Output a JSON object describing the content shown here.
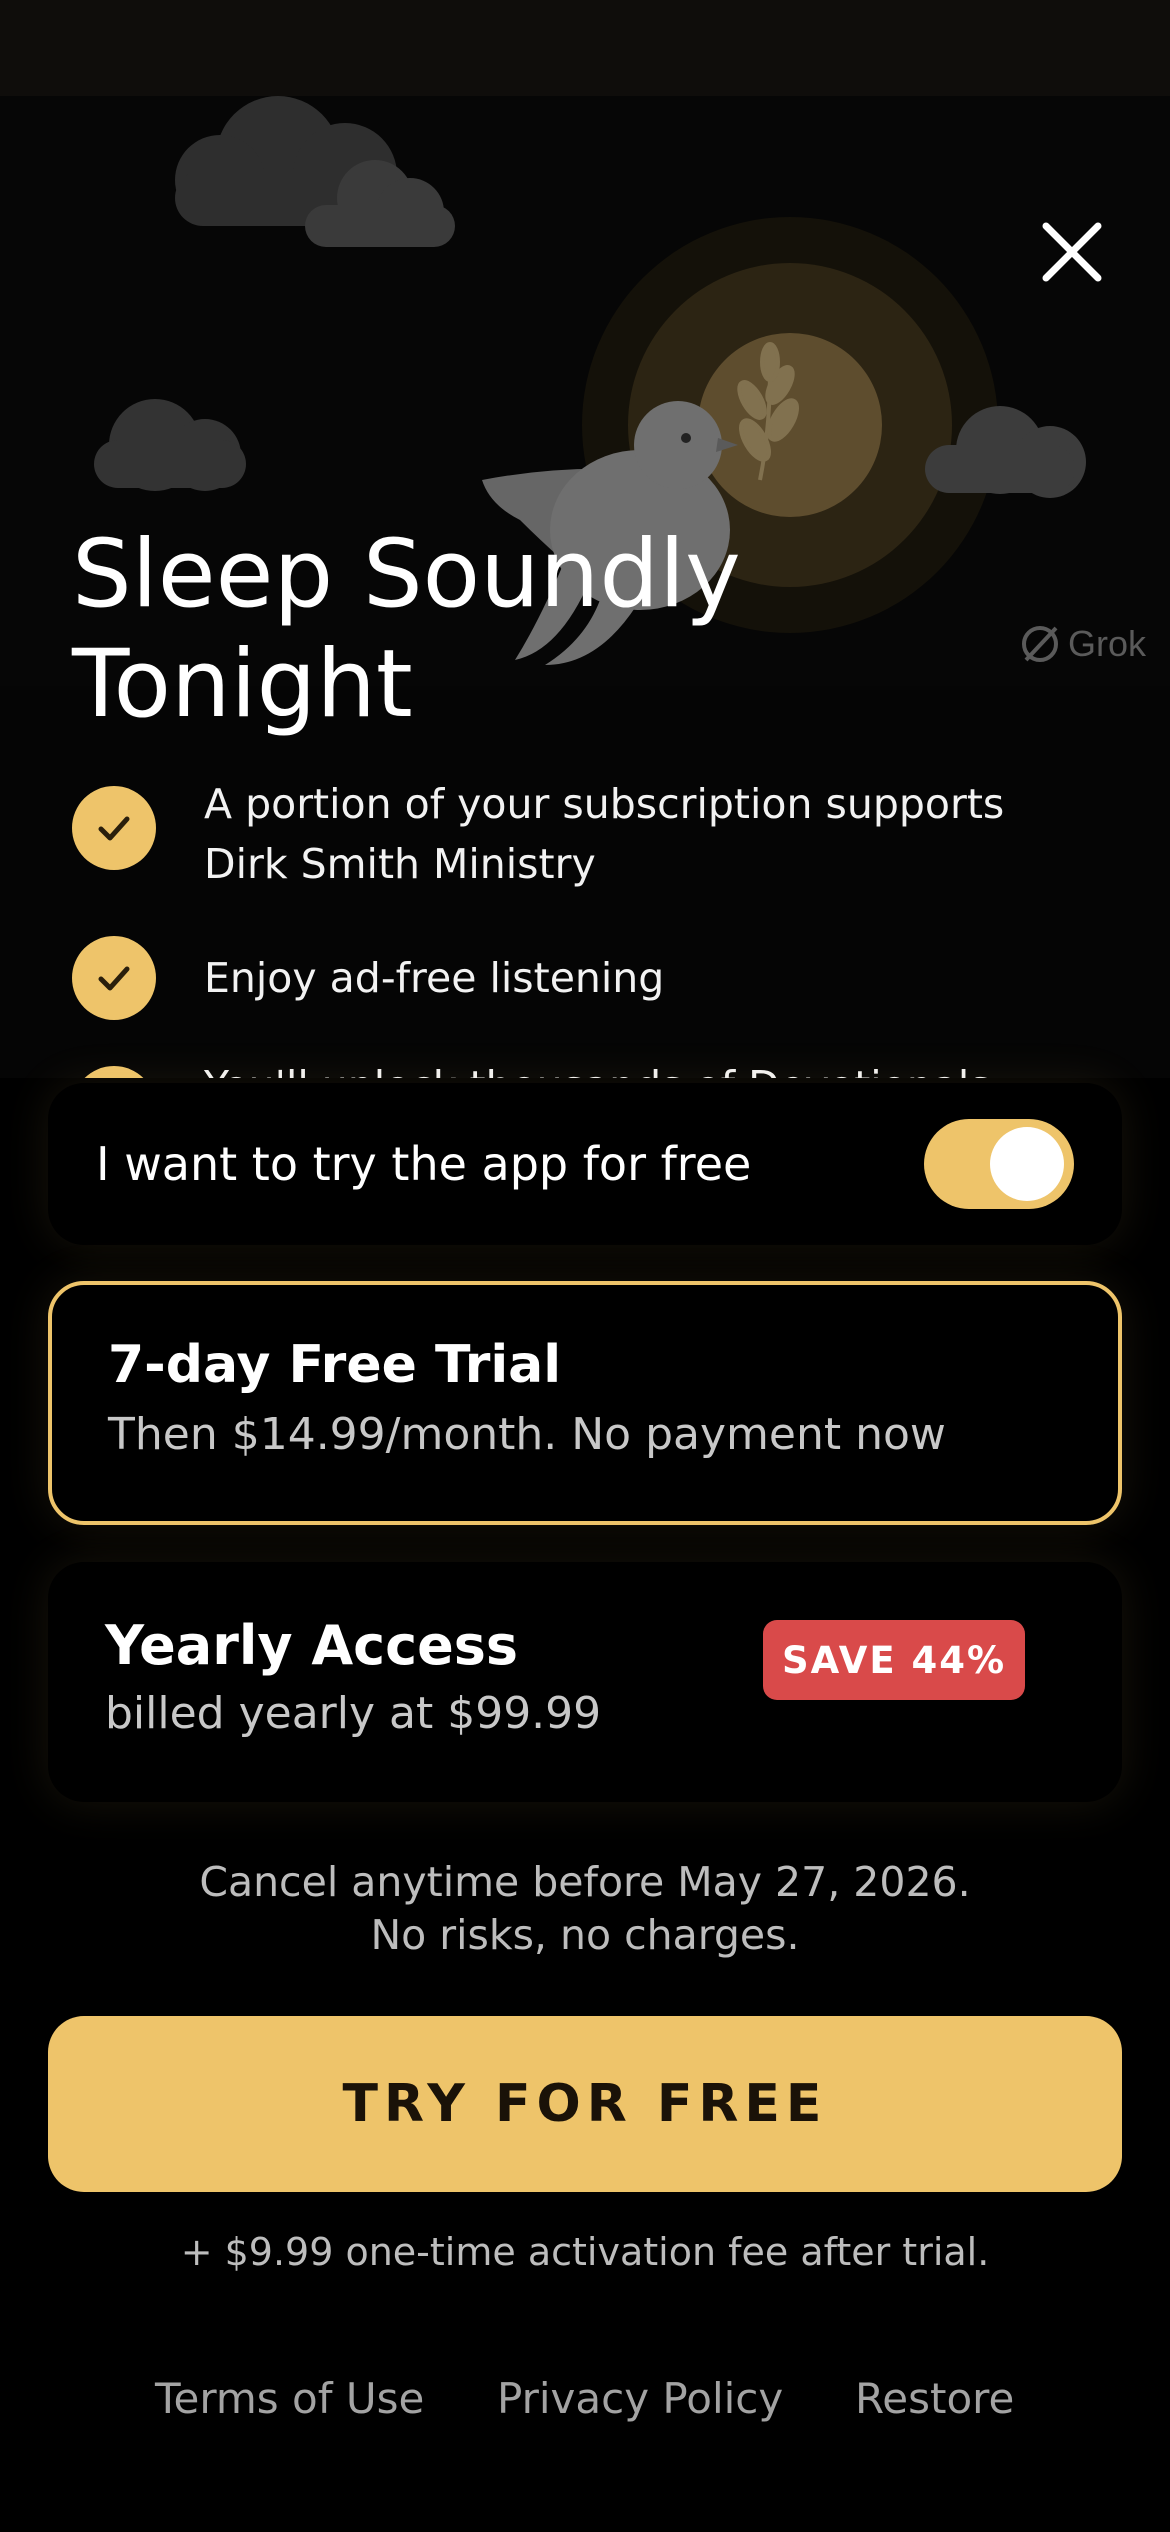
{
  "hero": {
    "title_line1": "Sleep Soundly",
    "title_line2": "Tonight",
    "watermark": "Grok"
  },
  "benefits": [
    {
      "line1": "A portion of your subscription supports",
      "line2": "Dirk Smith Ministry"
    },
    {
      "line1": "Enjoy ad-free listening"
    },
    {
      "line1": "You'll unlock thousands of Devotionals"
    }
  ],
  "trial_toggle": {
    "label": "I want to try the app for free",
    "on": true
  },
  "plans": {
    "trial": {
      "title": "7-day Free Trial",
      "subtitle": "Then $14.99/month. No payment now",
      "selected": true
    },
    "yearly": {
      "title": "Yearly Access",
      "subtitle": "billed yearly at $99.99",
      "badge": "SAVE 44%"
    }
  },
  "cancel_note": {
    "line1": "Cancel anytime before May 27, 2026.",
    "line2": "No risks, no charges."
  },
  "cta_label": "TRY FOR FREE",
  "fee_note": "+ $9.99 one-time activation fee after trial.",
  "footer": {
    "terms": "Terms of Use",
    "privacy": "Privacy Policy",
    "restore": "Restore"
  },
  "colors": {
    "accent": "#eec46a",
    "badge": "#d94a4a",
    "background": "#000000"
  },
  "icons": [
    "close-icon",
    "checkmark-icon",
    "dove-icon",
    "cloud-icon",
    "moon-icon",
    "olive-branch-icon",
    "grok-logo-icon"
  ]
}
